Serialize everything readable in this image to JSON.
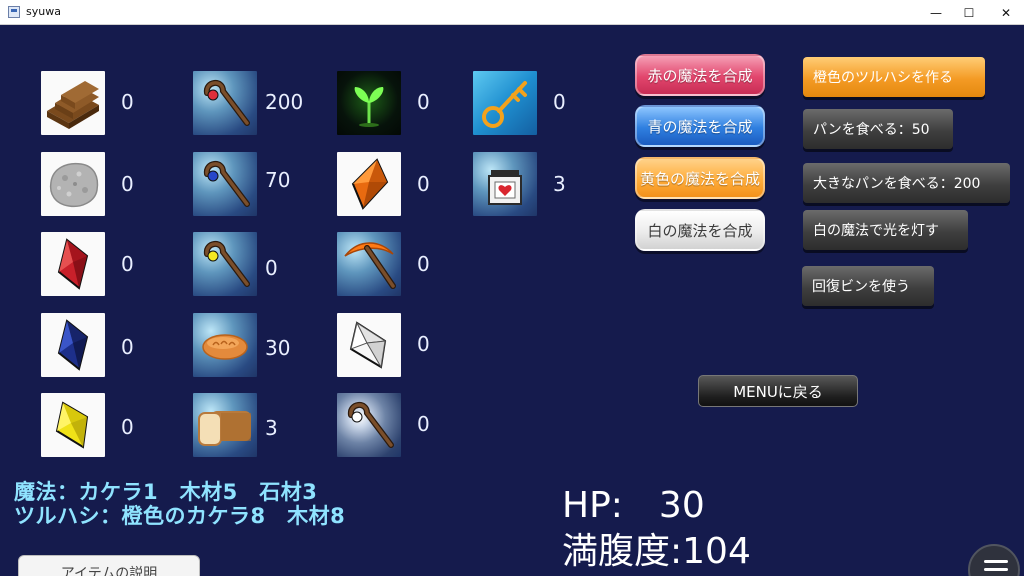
{
  "window": {
    "title": "syuwa",
    "controls": {
      "minimize": "—",
      "maximize": "☐",
      "close": "✕"
    }
  },
  "inventory": {
    "column1": [
      {
        "name": "wood",
        "icon": "wood-planks-icon",
        "count": "0"
      },
      {
        "name": "stone",
        "icon": "stone-icon",
        "count": "0"
      },
      {
        "name": "red-crystal",
        "icon": "red-crystal-icon",
        "count": "0"
      },
      {
        "name": "blue-crystal",
        "icon": "blue-crystal-icon",
        "count": "0"
      },
      {
        "name": "yellow-crystal",
        "icon": "yellow-crystal-icon",
        "count": "0"
      }
    ],
    "column2": [
      {
        "name": "red-staff",
        "icon": "red-staff-icon",
        "count": "200"
      },
      {
        "name": "blue-staff",
        "icon": "blue-staff-icon",
        "count": "70"
      },
      {
        "name": "yellow-staff",
        "icon": "yellow-staff-icon",
        "count": "0"
      },
      {
        "name": "bread",
        "icon": "bread-icon",
        "count": "30"
      },
      {
        "name": "big-bread",
        "icon": "loaf-icon",
        "count": "3"
      }
    ],
    "column3": [
      {
        "name": "sprout",
        "icon": "sprout-icon",
        "count": "0"
      },
      {
        "name": "orange-crystal",
        "icon": "orange-crystal-icon",
        "count": "0"
      },
      {
        "name": "orange-pickaxe",
        "icon": "pickaxe-icon",
        "count": "0"
      },
      {
        "name": "white-crystal",
        "icon": "white-crystal-icon",
        "count": "0"
      },
      {
        "name": "white-staff",
        "icon": "white-staff-icon",
        "count": "0"
      }
    ],
    "column4": [
      {
        "name": "key",
        "icon": "key-icon",
        "count": "0"
      },
      {
        "name": "recovery-bottle",
        "icon": "heart-bottle-icon",
        "count": "3"
      }
    ]
  },
  "magic_buttons": [
    {
      "label": "赤の魔法を合成",
      "color": "#e2466d"
    },
    {
      "label": "青の魔法を合成",
      "color": "#2f7fe0"
    },
    {
      "label": "黄色の魔法を合成",
      "color": "#ffad3b"
    },
    {
      "label": "白の魔法を合成",
      "color": "#ececec"
    }
  ],
  "action_buttons": [
    {
      "label": "橙色のツルハシを作る"
    },
    {
      "label": "パンを食べる：50"
    },
    {
      "label": "大きなパンを食べる：200"
    },
    {
      "label": "白の魔法で光を灯す"
    },
    {
      "label": "回復ビンを使う"
    }
  ],
  "menu_button": "MENUに戻る",
  "recipe": {
    "line1": "魔法：カケラ1　木材5　石材3",
    "line2": "ツルハシ：橙色のカケラ8　木材8"
  },
  "status": {
    "hp": "HP:　30",
    "fullness": "満腹度:104"
  },
  "item_description_button": "アイテムの説明",
  "colors": {
    "background": "#151b4d",
    "recipe_text": "#8fe3ff"
  }
}
